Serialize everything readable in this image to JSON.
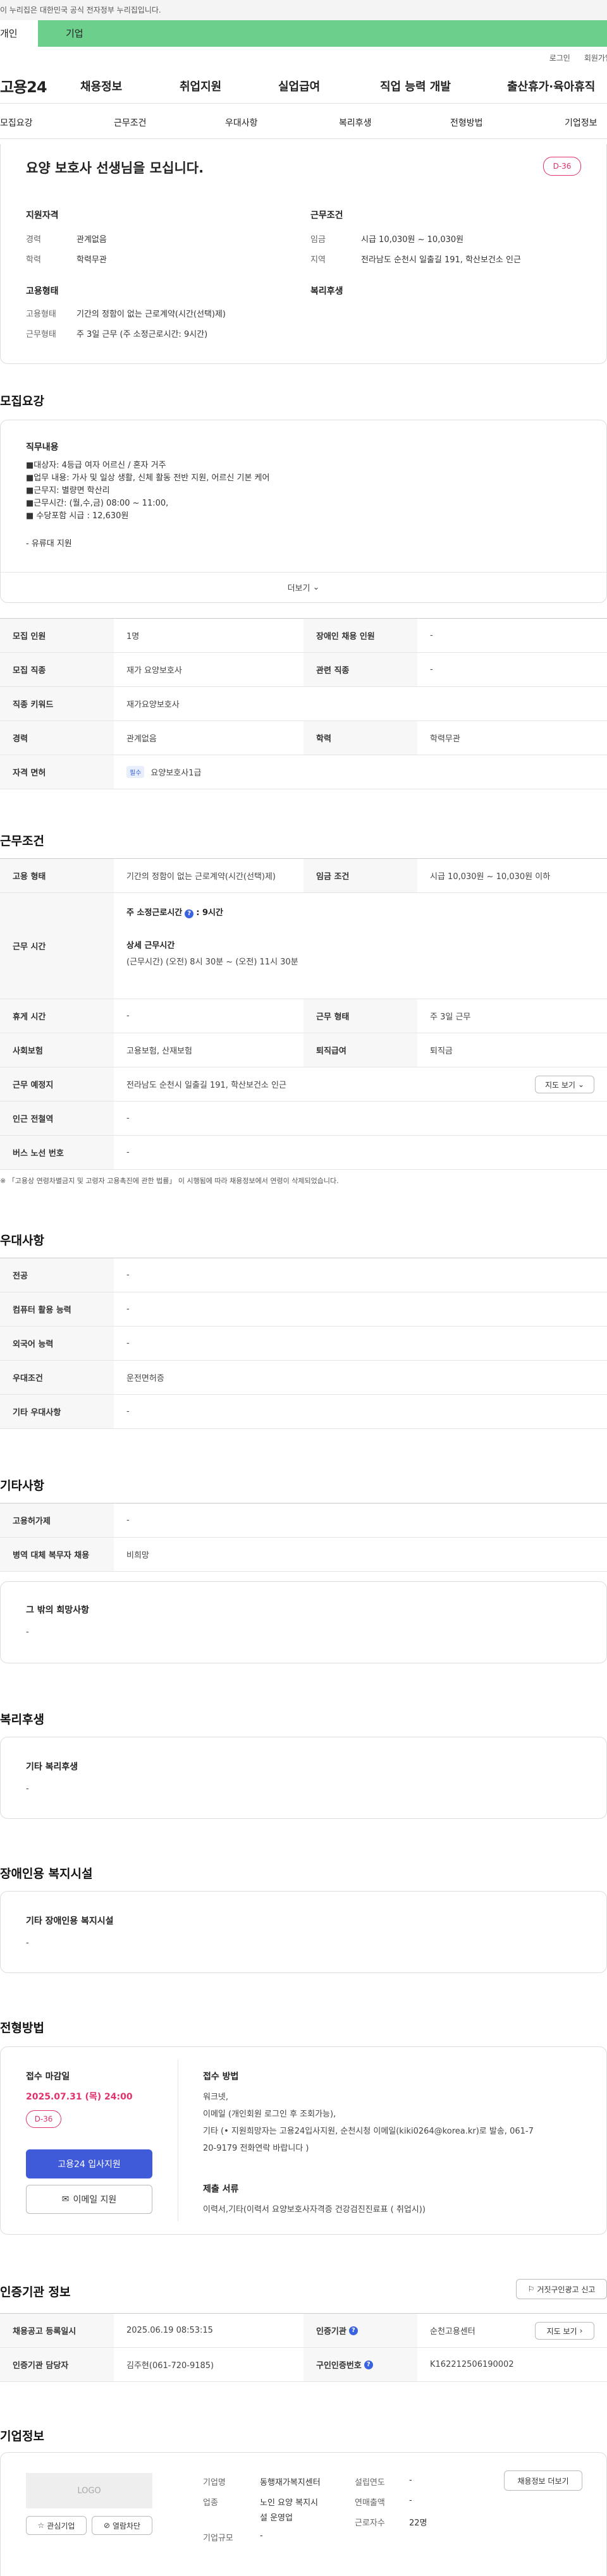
{
  "gov_banner": "이 누리집은 대한민국 공식 전자정부 누리집입니다.",
  "user_tabs": [
    "개인",
    "기업"
  ],
  "util": [
    "로그인",
    "회원가입"
  ],
  "logo": "고용24",
  "gnb": [
    "채용정보",
    "취업지원",
    "실업급여",
    "직업 능력 개발",
    "출산휴가·육아휴직"
  ],
  "subnav": [
    "모집요강",
    "근무조건",
    "우대사항",
    "복리후생",
    "전형방법",
    "기업정보"
  ],
  "summary": {
    "title": "요양 보호사 선생님을 모십니다.",
    "dday": "D-36",
    "qual_title": "지원자격",
    "cond_title": "근무조건",
    "career_lbl": "경력",
    "career_val": "관계없음",
    "edu_lbl": "학력",
    "edu_val": "학력무관",
    "wage_lbl": "임금",
    "wage_val": "시급 10,030원 ~ 10,030원",
    "area_lbl": "지역",
    "area_val": "전라남도 순천시 일출길 191, 학산보건소 인근",
    "emp_title": "고용형태",
    "welfare_title": "복리후생",
    "emp_lbl": "고용형태",
    "emp_val": "기간의 정함이 없는 근로계약(시간(선택)제)",
    "work_lbl": "근무형태",
    "work_val": "주 3일 근무 (주 소정근로시간: 9시간)"
  },
  "recruit": {
    "heading": "모집요강",
    "job_title": "직무내용",
    "job_lines": [
      "■대상자:  4등급 여자 어르신  / 혼자 거주",
      "■업무 내용: 가사 및 일상 생활, 신체 활동  전반 지원,   어르신 기본 케어",
      "■근무지:  별량면 학산리",
      "■근무시간: (월,수,금) 08:00 ~ 11:00,",
      "■ 수당포함 시급 : 12,630원",
      "",
      "- 유류대 지원"
    ],
    "more": "더보기",
    "rows": [
      {
        "th": "모집 인원",
        "td": "1명",
        "th2": "장애인 채용 인원",
        "td2": "-"
      },
      {
        "th": "모집 직종",
        "td": "재가 요양보호사",
        "th2": "관련 직종",
        "td2": "-"
      },
      {
        "th": "직종 키워드",
        "td": "재가요양보호사"
      },
      {
        "th": "경력",
        "td": "관계없음",
        "th2": "학력",
        "td2": "학력무관"
      },
      {
        "th": "자격 면허",
        "badge": "필수",
        "td": "요양보호사1급"
      }
    ]
  },
  "conditions": {
    "heading": "근무조건",
    "emp_type": "고용 형태",
    "emp_type_val": "기간의 정함이 없는 근로계약(시간(선택)제)",
    "wage": "임금 조건",
    "wage_val": "시급 10,030원 ~ 10,030원 이하",
    "hours": "근무 시간",
    "hours_week": "주 소정근로시간",
    "hours_q": "?",
    "hours_week_val": ": 9시간",
    "hours_detail_title": "상세 근무시간",
    "hours_detail": "(근무시간) (오전) 8시 30분 ~ (오전) 11시 30분",
    "rest": "휴게 시간",
    "rest_val": "-",
    "form": "근무 형태",
    "form_val": "주 3일 근무",
    "insurance": "사회보험",
    "insurance_val": "고용보험, 산재보험",
    "severance": "퇴직급여",
    "severance_val": "퇴직금",
    "place": "근무 예정지",
    "place_val": "전라남도 순천시 일출길 191, 학산보건소 인근",
    "map_btn": "지도 보기",
    "subway": "인근 전철역",
    "subway_val": "-",
    "bus": "버스 노선 번호",
    "bus_val": "-",
    "note": "※ 「고용상 연령차별금지 및 고령자 고용촉진에 관한 법률」 이 시행됨에 따라 채용정보에서 연령이 삭제되었습니다."
  },
  "preference": {
    "heading": "우대사항",
    "rows": [
      [
        "전공",
        "-"
      ],
      [
        "컴퓨터 활용 능력",
        "-"
      ],
      [
        "외국어 능력",
        "-"
      ],
      [
        "우대조건",
        "운전면허증"
      ],
      [
        "기타 우대사항",
        "-"
      ]
    ]
  },
  "etc": {
    "heading": "기타사항",
    "rows": [
      [
        "고용허가제",
        "-"
      ],
      [
        "병역 대체 복무자 채용",
        "비희망"
      ]
    ],
    "other_title": "그 밖의 희망사항",
    "other_val": "-"
  },
  "welfare": {
    "heading": "복리후생",
    "title": "기타 복리후생",
    "val": "-"
  },
  "disabled": {
    "heading": "장애인용 복지시설",
    "title": "기타 장애인용 복지시설",
    "val": "-"
  },
  "apply": {
    "heading": "전형방법",
    "deadline_title": "접수 마감일",
    "deadline": "2025.07.31 (목) 24:00",
    "dday": "D-36",
    "apply_btn": "고용24 입사지원",
    "email_btn": "이메일 지원",
    "method_title": "접수 방법",
    "method_lines": [
      "워크넷,",
      "이메일 (개인회원 로그인 후 조회가능),",
      "기타 (• 지원희망자는 고용24입사지원, 순천시청 이메일(kiki0264@korea.kr)로 발송, 061-7",
      "20-9179 전화연락 바랍니다 )"
    ],
    "docs_title": "제출 서류",
    "docs": "이력서,기타(이력서 요양보호사자격증 건강검진진료표 ( 취업시))"
  },
  "cert": {
    "heading": "인증기관 정보",
    "report_btn": "거짓구인광고 신고",
    "reg": "채용공고 등록일시",
    "reg_val": "2025.06.19 08:53:15",
    "org": "인증기관",
    "org_val": "순천고용센터",
    "map_btn": "지도 보기",
    "mgr": "인증기관 담당자",
    "mgr_val": "김주현(061-720-9185)",
    "num": "구인인증번호",
    "num_val": "K162212506190002"
  },
  "company": {
    "heading": "기업정보",
    "logo": "LOGO",
    "fav": "관심기업",
    "block": "열람차단",
    "name_lbl": "기업명",
    "name_val": "동행재가복지센터",
    "ind_lbl": "업종",
    "ind_val1": "노인 요양 복지시",
    "ind_val2": "설 운영업",
    "size_lbl": "기업규모",
    "size_val": "-",
    "year_lbl": "설립연도",
    "year_val": "-",
    "sales_lbl": "연매출액",
    "sales_val": "-",
    "emp_lbl": "근로자수",
    "emp_val": "22명",
    "view_btn": "채용정보 더보기"
  }
}
